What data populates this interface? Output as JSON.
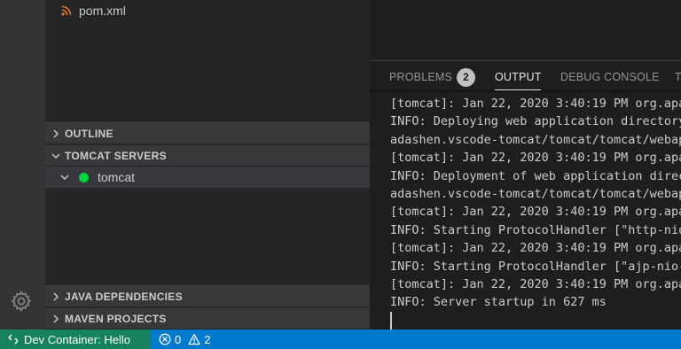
{
  "explorer": {
    "file": {
      "name": "pom.xml",
      "icon": "rss-icon"
    }
  },
  "sidebar": {
    "sections": {
      "outline": "OUTLINE",
      "tomcat_servers": "TOMCAT SERVERS",
      "java_dependencies": "JAVA DEPENDENCIES",
      "maven_projects": "MAVEN PROJECTS"
    },
    "servers": [
      {
        "name": "tomcat",
        "status": "running",
        "status_color": "#00d53b"
      }
    ]
  },
  "panel": {
    "tabs": {
      "problems": "PROBLEMS",
      "problems_count": "2",
      "output": "OUTPUT",
      "debug_console": "DEBUG CONSOLE",
      "terminal": "T"
    },
    "active_tab": "OUTPUT",
    "output_lines": [
      "[tomcat]: Jan 22, 2020 3:40:19 PM org.apa",
      "INFO: Deploying web application directory",
      "adashen.vscode-tomcat/tomcat/tomcat/webap",
      "[tomcat]: Jan 22, 2020 3:40:19 PM org.apa",
      "INFO: Deployment of web application direc",
      "adashen.vscode-tomcat/tomcat/tomcat/webap",
      "[tomcat]: Jan 22, 2020 3:40:19 PM org.apa",
      "INFO: Starting ProtocolHandler [\"http-nio",
      "[tomcat]: Jan 22, 2020 3:40:19 PM org.apa",
      "INFO: Starting ProtocolHandler [\"ajp-nio-",
      "[tomcat]: Jan 22, 2020 3:40:19 PM org.apa",
      "INFO: Server startup in 627 ms"
    ]
  },
  "statusbar": {
    "remote_label": "Dev Container: Hello",
    "errors": "0",
    "warnings": "2",
    "colors": {
      "bar": "#007acc",
      "remote": "#16825d"
    }
  },
  "colors": {
    "accent_green": "#00d53b",
    "background": "#1e1e1e",
    "sidebar": "#252526"
  }
}
